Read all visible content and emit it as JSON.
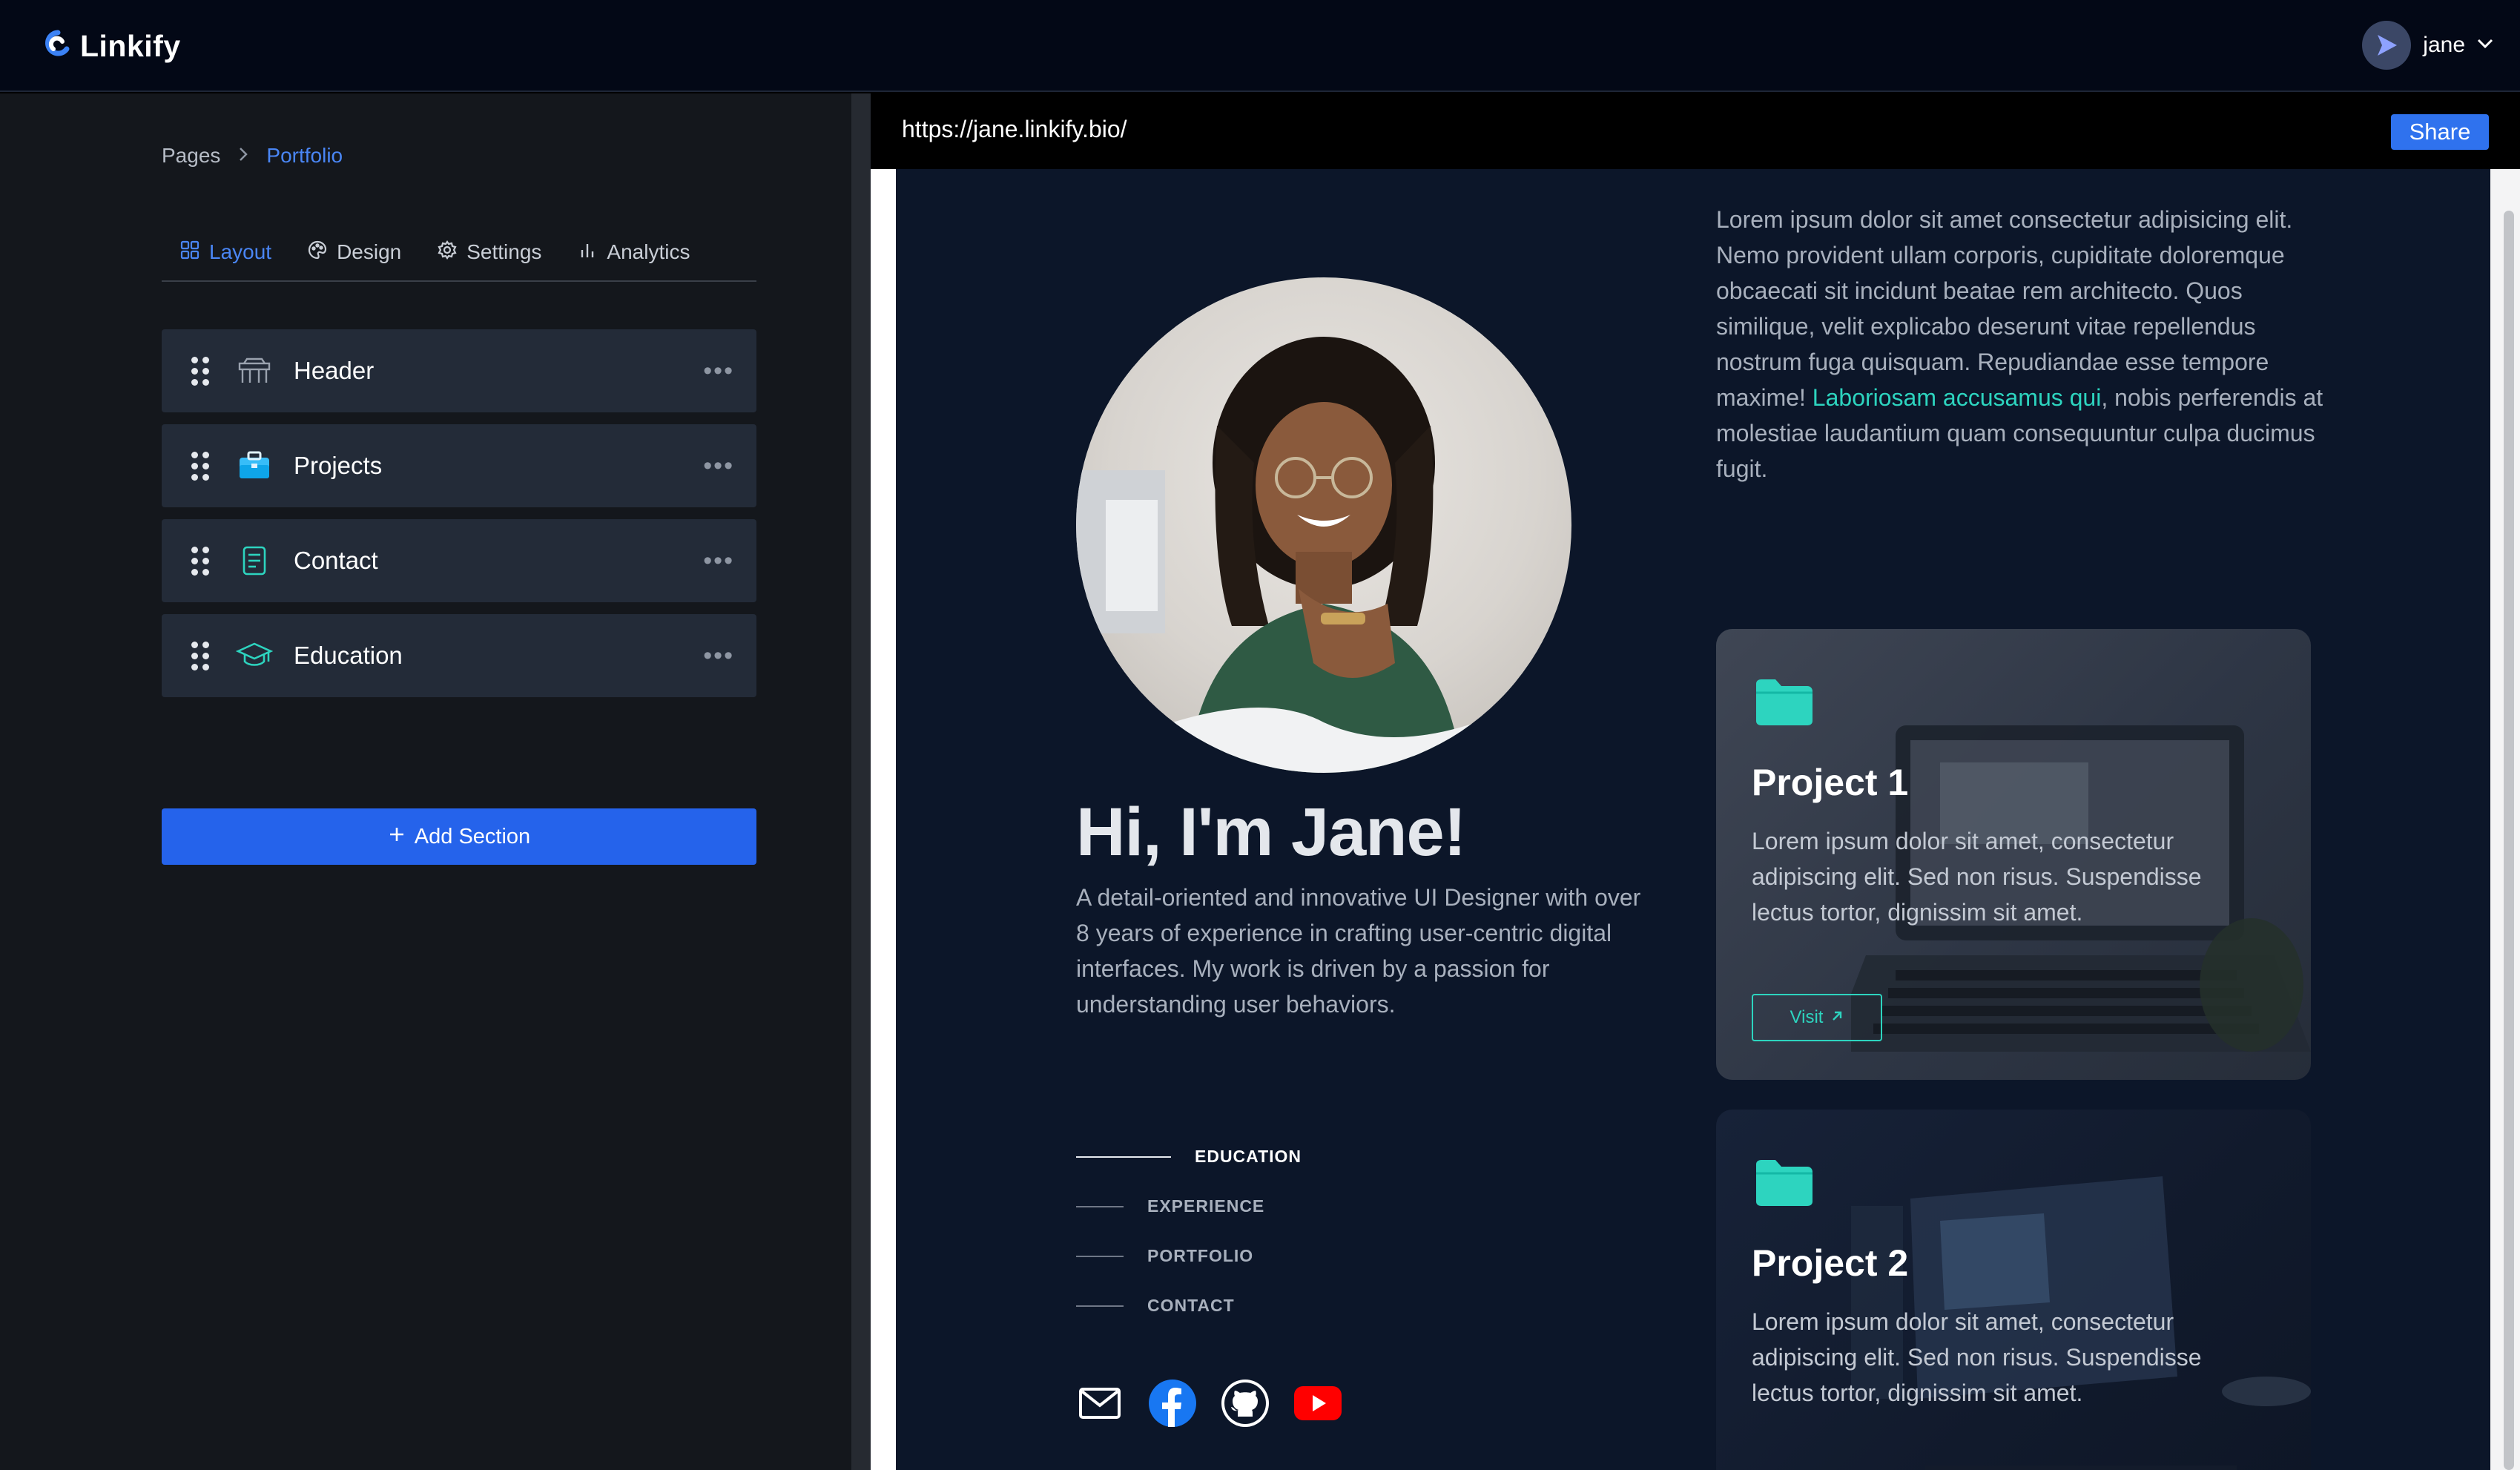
{
  "app": {
    "name": "Linkify"
  },
  "user": {
    "name": "jane"
  },
  "breadcrumb": {
    "root": "Pages",
    "current": "Portfolio"
  },
  "tabs": [
    {
      "label": "Layout",
      "icon": "grid-icon",
      "active": true
    },
    {
      "label": "Design",
      "icon": "palette-icon",
      "active": false
    },
    {
      "label": "Settings",
      "icon": "gear-icon",
      "active": false
    },
    {
      "label": "Analytics",
      "icon": "bar-chart-icon",
      "active": false
    }
  ],
  "sections": [
    {
      "label": "Header",
      "icon": "header-icon"
    },
    {
      "label": "Projects",
      "icon": "briefcase-icon"
    },
    {
      "label": "Contact",
      "icon": "contact-card-icon"
    },
    {
      "label": "Education",
      "icon": "graduation-cap-icon"
    }
  ],
  "add_section_label": "Add Section",
  "preview": {
    "url": "https://jane.linkify.bio/",
    "share_label": "Share",
    "hero_title": "Hi, I'm Jane!",
    "hero_desc": "A detail-oriented and innovative UI Designer with over 8 years of experience in crafting user-centric digital interfaces. My work is driven by a passion for understanding user behaviors.",
    "nav": [
      {
        "label": "EDUCATION",
        "active": true
      },
      {
        "label": "EXPERIENCE",
        "active": false
      },
      {
        "label": "PORTFOLIO",
        "active": false
      },
      {
        "label": "CONTACT",
        "active": false
      }
    ],
    "socials": [
      "mail-icon",
      "facebook-icon",
      "github-icon",
      "youtube-icon"
    ],
    "about_pre": "Lorem ipsum dolor sit amet consectetur adipisicing elit. Nemo provident ullam corporis, cupiditate doloremque obcaecati sit incidunt beatae rem architecto. Quos similique, velit explicabo deserunt vitae repellendus nostrum fuga quisquam. Repudiandae esse tempore maxime! ",
    "about_link": "Laboriosam accusamus qui",
    "about_post": ", nobis perferendis at molestiae laudantium quam consequuntur culpa ducimus fugit.",
    "projects": [
      {
        "title": "Project 1",
        "desc": "Lorem ipsum dolor sit amet, consectetur adipiscing elit. Sed non risus. Suspendisse lectus tortor, dignissim sit amet.",
        "button": "Visit"
      },
      {
        "title": "Project 2",
        "desc": "Lorem ipsum dolor sit amet, consectetur adipiscing elit. Sed non risus. Suspendisse lectus tortor, dignissim sit amet."
      }
    ]
  },
  "colors": {
    "accent_blue": "#2563eb",
    "accent_teal": "#2dd4bf",
    "page_bg": "#0c1629",
    "panel_bg": "#14171c",
    "row_bg": "#232b38"
  }
}
